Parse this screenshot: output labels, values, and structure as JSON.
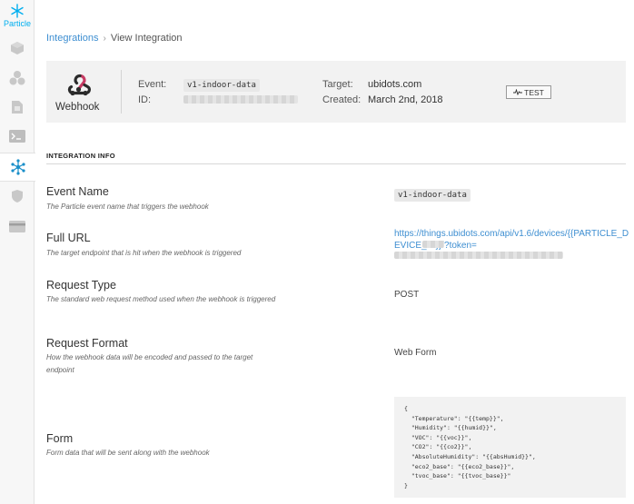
{
  "sidebar": {
    "logo_label": "Particle",
    "items": [
      {
        "icon": "cube-icon"
      },
      {
        "icon": "cluster-icon"
      },
      {
        "icon": "sim-card-icon"
      },
      {
        "icon": "terminal-icon"
      },
      {
        "icon": "integrations-icon",
        "active": true
      },
      {
        "icon": "shield-icon"
      },
      {
        "icon": "credit-card-icon"
      }
    ]
  },
  "breadcrumb": {
    "parent": "Integrations",
    "separator": "›",
    "current": "View Integration"
  },
  "header": {
    "type_label": "Webhook",
    "event_label": "Event:",
    "event_value": "v1-indoor-data",
    "id_label": "ID:",
    "target_label": "Target:",
    "target_value": "ubidots.com",
    "created_label": "Created:",
    "created_value": "March 2nd, 2018",
    "test_button": "TEST"
  },
  "section": {
    "title": "INTEGRATION INFO"
  },
  "fields": {
    "event_name": {
      "name": "Event Name",
      "desc": "The Particle event name that triggers the webhook",
      "value": "v1-indoor-data"
    },
    "full_url": {
      "name": "Full URL",
      "desc": "The target endpoint that is hit when the webhook is triggered",
      "value": "https://things.ubidots.com/api/v1.6/devices/{{PARTICLE_DEVICE_ID}}/?token="
    },
    "request_type": {
      "name": "Request Type",
      "desc": "The standard web request method used when the webhook is triggered",
      "value": "POST"
    },
    "request_format": {
      "name": "Request Format",
      "desc": "How the webhook data will be encoded and passed to the target endpoint",
      "value": "Web Form"
    },
    "form": {
      "name": "Form",
      "desc": "Form data that will be sent along with the webhook",
      "value": "{\n  \"Temperature\": \"{{temp}}\",\n  \"Humidity\": \"{{humid}}\",\n  \"VOC\": \"{{voc}}\",\n  \"CO2\": \"{{co2}}\",\n  \"AbsoluteHumidity\": \"{{absHumid}}\",\n  \"eco2_base\": \"{{eco2_base}}\",\n  \"tvoc_base\": \"{{tvoc_base}}\"\n}"
    }
  },
  "colors": {
    "brand": "#00aeef",
    "link": "#3d8ed1",
    "webhook_red": "#c73a63",
    "webhook_dark": "#2b2b2b"
  }
}
